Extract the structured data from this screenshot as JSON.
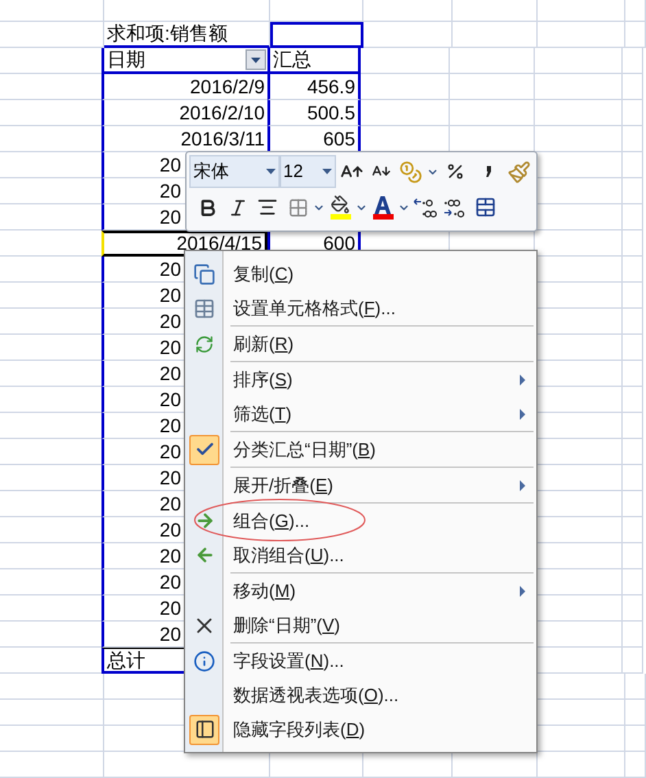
{
  "pivot": {
    "value_field": "求和项:销售额",
    "row_field": "日期",
    "total_header": "汇总",
    "rows": [
      {
        "date": "2016/2/9",
        "total": "456.9",
        "selected": false
      },
      {
        "date": "2016/2/10",
        "total": "500.5",
        "selected": false
      },
      {
        "date": "2016/3/11",
        "total": "605",
        "selected": false
      },
      {
        "date": "20",
        "selected": false
      },
      {
        "date": "20",
        "selected": false
      },
      {
        "date": "20",
        "selected": false
      },
      {
        "date": "2016/4/15",
        "total": "600",
        "selected": true
      },
      {
        "date": "20",
        "selected": false
      },
      {
        "date": "20",
        "selected": false
      },
      {
        "date": "20",
        "selected": false
      },
      {
        "date": "20",
        "selected": false
      },
      {
        "date": "20",
        "selected": false
      },
      {
        "date": "20",
        "selected": false
      },
      {
        "date": "20",
        "selected": false
      },
      {
        "date": "20",
        "selected": false
      },
      {
        "date": "20",
        "selected": false
      },
      {
        "date": "20",
        "selected": false
      },
      {
        "date": "20",
        "selected": false
      },
      {
        "date": "20",
        "selected": false
      },
      {
        "date": "20",
        "selected": false
      },
      {
        "date": "20",
        "selected": false
      },
      {
        "date": "20",
        "selected": false
      }
    ],
    "grand_total_label": "总计"
  },
  "mini_toolbar": {
    "font": "宋体",
    "size": "12"
  },
  "context_menu": {
    "items": [
      {
        "kind": "item",
        "before": "复制(",
        "key": "C",
        "after": ")",
        "checked": false,
        "submenu": false,
        "circled": false
      },
      {
        "kind": "item",
        "before": "设置单元格格式(",
        "key": "F",
        "after": ")...",
        "checked": false,
        "submenu": false,
        "circled": false
      },
      {
        "kind": "separator"
      },
      {
        "kind": "item",
        "before": "刷新(",
        "key": "R",
        "after": ")",
        "checked": false,
        "submenu": false,
        "circled": false
      },
      {
        "kind": "separator"
      },
      {
        "kind": "item",
        "before": "排序(",
        "key": "S",
        "after": ")",
        "checked": false,
        "submenu": true,
        "circled": false
      },
      {
        "kind": "item",
        "before": "筛选(",
        "key": "T",
        "after": ")",
        "checked": false,
        "submenu": true,
        "circled": false
      },
      {
        "kind": "separator"
      },
      {
        "kind": "item",
        "before": "分类汇总“日期”(",
        "key": "B",
        "after": ")",
        "checked": true,
        "submenu": false,
        "circled": false
      },
      {
        "kind": "separator"
      },
      {
        "kind": "item",
        "before": "展开/折叠(",
        "key": "E",
        "after": ")",
        "checked": false,
        "submenu": true,
        "circled": false
      },
      {
        "kind": "separator"
      },
      {
        "kind": "item",
        "before": "组合(",
        "key": "G",
        "after": ")...",
        "checked": false,
        "submenu": false,
        "circled": true
      },
      {
        "kind": "item",
        "before": "取消组合(",
        "key": "U",
        "after": ")...",
        "checked": false,
        "submenu": false,
        "circled": false
      },
      {
        "kind": "separator"
      },
      {
        "kind": "item",
        "before": "移动(",
        "key": "M",
        "after": ")",
        "checked": false,
        "submenu": true,
        "circled": false
      },
      {
        "kind": "item",
        "before": "删除“日期”(",
        "key": "V",
        "after": ")",
        "checked": false,
        "submenu": false,
        "circled": false
      },
      {
        "kind": "separator"
      },
      {
        "kind": "item",
        "before": "字段设置(",
        "key": "N",
        "after": ")...",
        "checked": false,
        "submenu": false,
        "circled": false
      },
      {
        "kind": "item",
        "before": "数据透视表选项(",
        "key": "O",
        "after": ")...",
        "checked": false,
        "submenu": false,
        "circled": false
      },
      {
        "kind": "item",
        "before": "隐藏字段列表(",
        "key": "D",
        "after": ")",
        "checked": true,
        "submenu": false,
        "circled": false
      }
    ]
  }
}
